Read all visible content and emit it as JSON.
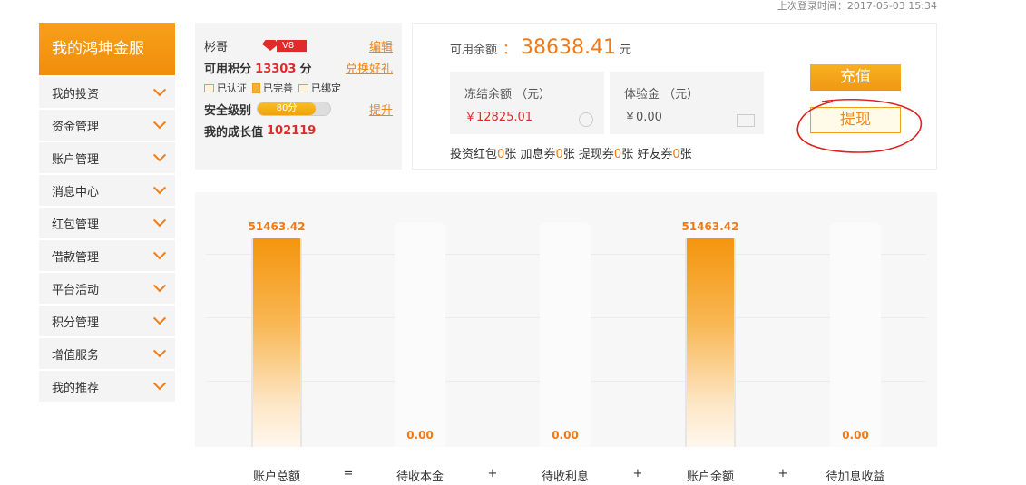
{
  "header": {
    "last_login": "上次登录时间：2017-05-03 15:34"
  },
  "sidebar": {
    "title": "我的鸿坤金服",
    "items": [
      {
        "label": "我的投资"
      },
      {
        "label": "资金管理"
      },
      {
        "label": "账户管理"
      },
      {
        "label": "消息中心"
      },
      {
        "label": "红包管理"
      },
      {
        "label": "借款管理"
      },
      {
        "label": "平台活动"
      },
      {
        "label": "积分管理"
      },
      {
        "label": "增值服务"
      },
      {
        "label": "我的推荐"
      }
    ]
  },
  "user": {
    "name": "彬哥",
    "vip_level": "V8",
    "edit_label": "编辑",
    "points_label": "可用积分",
    "points_value": "13303",
    "points_unit": "分",
    "exchange_label": "兑换好礼",
    "badges": [
      "已认证",
      "已完善",
      "已绑定"
    ],
    "security_label": "安全级别",
    "security_value": "80分",
    "security_level": 0.8,
    "upgrade_label": "提升",
    "growth_label": "我的成长值",
    "growth_value": "102119"
  },
  "balance": {
    "available_label": "可用余额",
    "available_colon": "：",
    "available_value": "38638.41",
    "available_unit": "元",
    "frozen_label": "冻结余额 （元）",
    "frozen_value": "￥12825.01",
    "trial_label": "体验金 （元）",
    "trial_value": "￥0.00",
    "coupons": [
      {
        "label": "投资红包",
        "count": "0",
        "unit": "张"
      },
      {
        "label": "加息券",
        "count": "0",
        "unit": "张"
      },
      {
        "label": "提现券",
        "count": "0",
        "unit": "张"
      },
      {
        "label": "好友券",
        "count": "0",
        "unit": "张"
      }
    ],
    "recharge_label": "充值",
    "withdraw_label": "提现"
  },
  "colors": {
    "accent": "#f18d0c",
    "annotation": "#e02020",
    "value_red": "#e02b2b"
  },
  "chart_data": {
    "type": "bar",
    "categories": [
      "账户总额",
      "待收本金",
      "待收利息",
      "账户余额",
      "待加息收益"
    ],
    "values": [
      51463.42,
      0.0,
      0.0,
      51463.42,
      0.0
    ],
    "value_labels": [
      "51463.42",
      "0.00",
      "0.00",
      "51463.42",
      "0.00"
    ],
    "operators": [
      "=",
      "+",
      "+",
      "+"
    ],
    "ylim": [
      0,
      51463.42
    ],
    "grid": true
  }
}
